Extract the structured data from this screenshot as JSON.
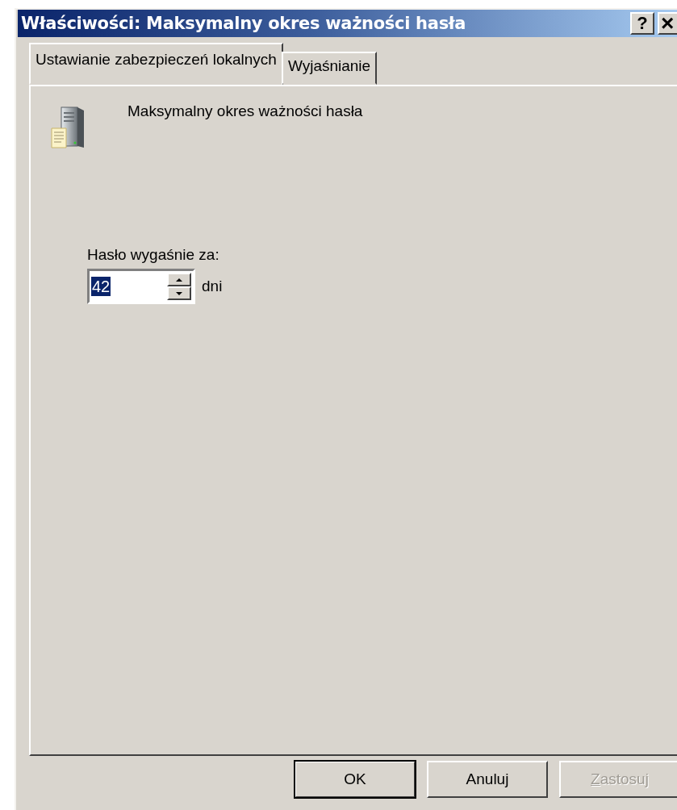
{
  "window": {
    "title": "Właściwości: Maksymalny okres ważności hasła",
    "title_buttons": [
      {
        "kind": "help",
        "label": "?"
      },
      {
        "kind": "close",
        "label": "×"
      }
    ]
  },
  "tabs": [
    {
      "label": "Ustawianie zabezpieczeń lokalnych",
      "selected": true
    },
    {
      "label": "Wyjaśnianie",
      "selected": false
    }
  ],
  "policy": {
    "name": "Maksymalny okres ważności hasła"
  },
  "setting": {
    "label": "Hasło wygaśnie za:",
    "value": "42",
    "value_selected": true,
    "unit": "dni"
  },
  "buttons": [
    {
      "label": "OK",
      "default": true,
      "disabled": false,
      "mnemonic": false
    },
    {
      "label": "Anuluj",
      "default": false,
      "disabled": false,
      "mnemonic": false
    },
    {
      "label": "Zastosuj",
      "default": false,
      "disabled": true,
      "mnemonic": true
    }
  ]
}
